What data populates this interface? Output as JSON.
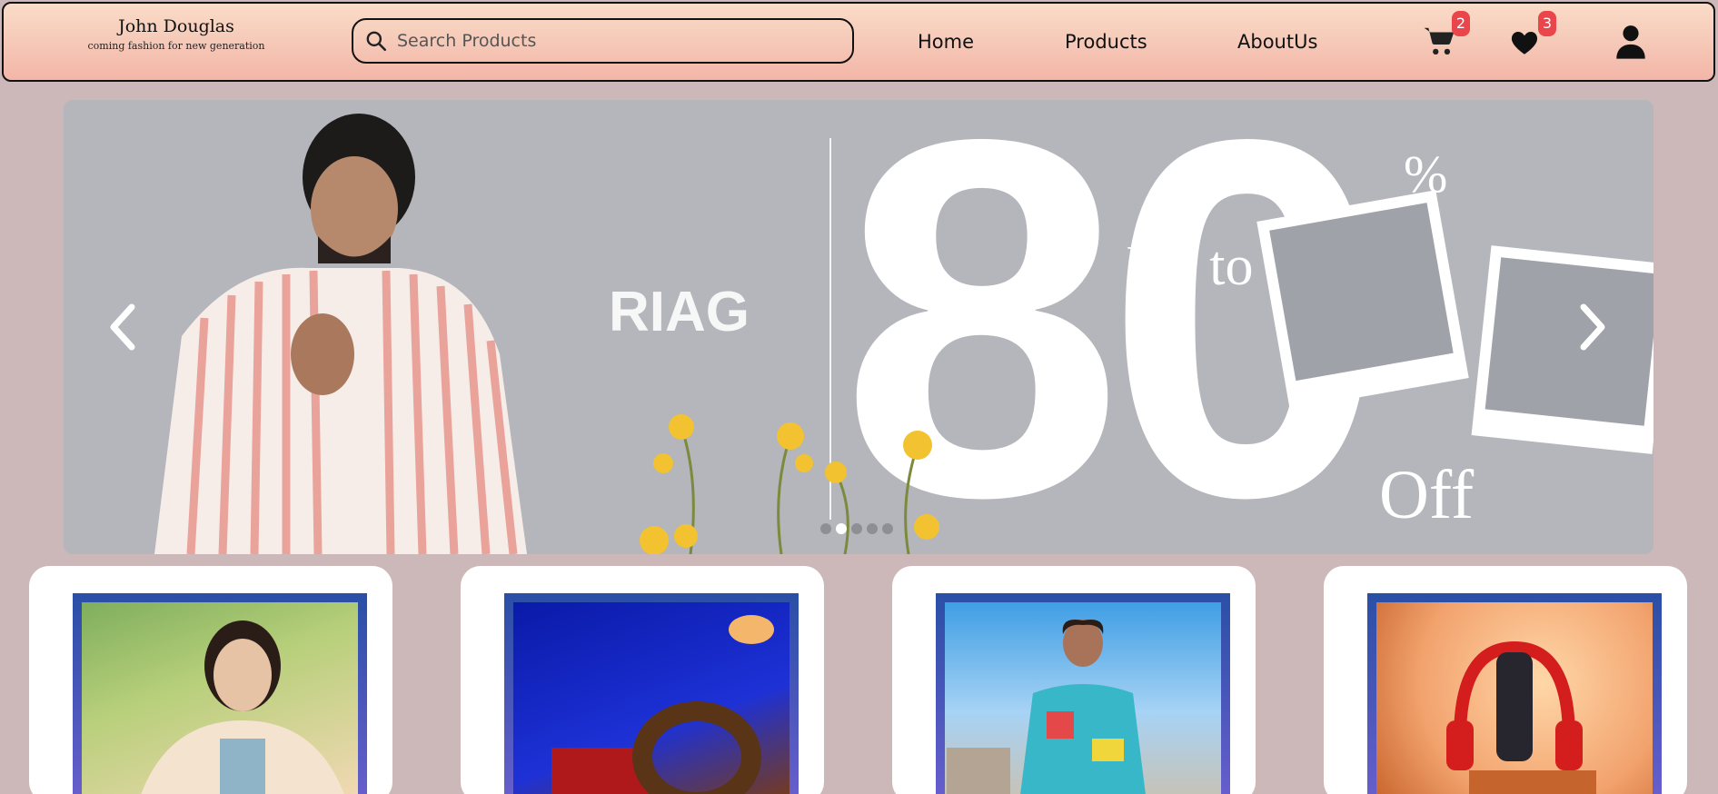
{
  "brand": {
    "name": "John Douglas",
    "tagline": "coming fashion for new generation"
  },
  "search": {
    "placeholder": "Search Products",
    "value": ""
  },
  "nav": {
    "home": "Home",
    "products": "Products",
    "about": "AboutUs"
  },
  "cart": {
    "count": "2"
  },
  "wishlist": {
    "count": "3"
  },
  "colors": {
    "header_start": "#f9dcc8",
    "header_end": "#f3b6a8",
    "page_bg": "#cdb8b9",
    "badge": "#e9454a",
    "card_frame": "#2a4fa6"
  },
  "carousel": {
    "brand_text": "RIAG",
    "big_number": "80",
    "percent": "%",
    "up_to": "Up to",
    "off": "Off",
    "slide_count": 5,
    "active_slide": 1
  },
  "products": [
    {
      "icon": "woman-blazer-image"
    },
    {
      "icon": "bag-belt-image"
    },
    {
      "icon": "man-printed-shirt-image"
    },
    {
      "icon": "headphones-speaker-image"
    }
  ]
}
